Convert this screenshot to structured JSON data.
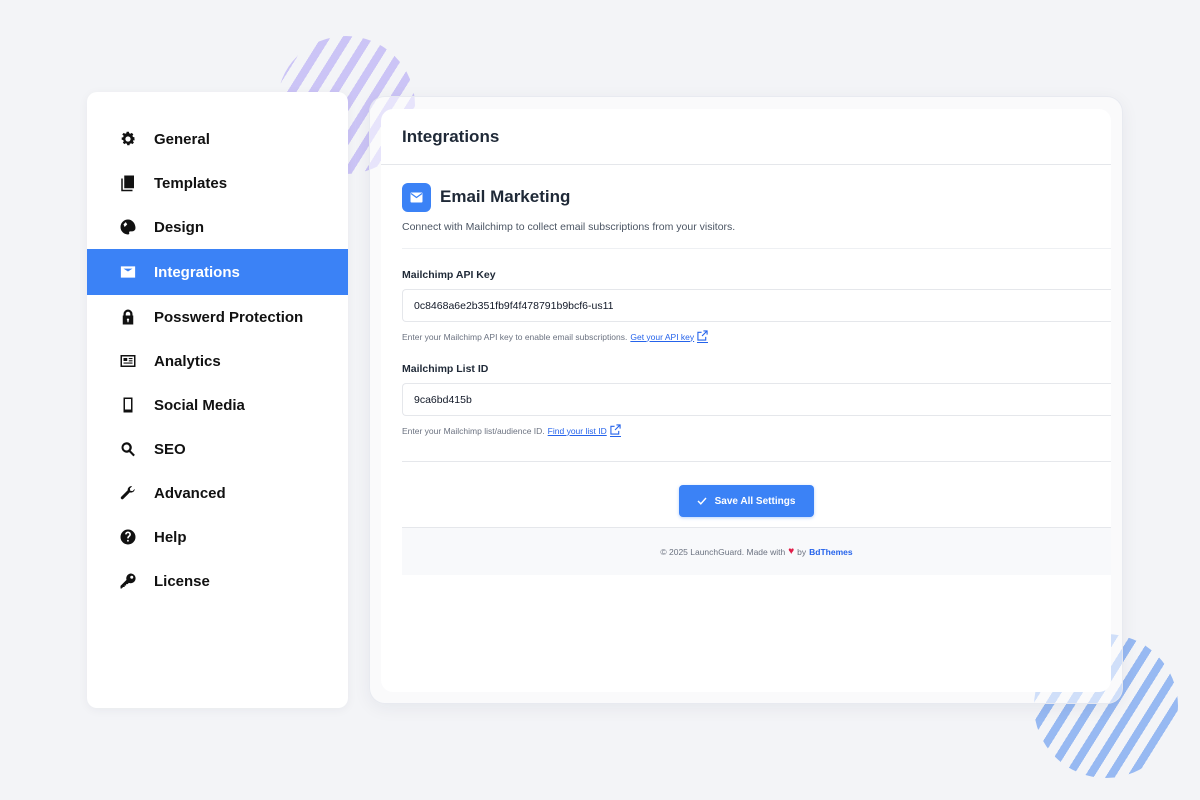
{
  "sidebar": {
    "items": [
      {
        "label": "General",
        "icon": "gear-icon",
        "active": false
      },
      {
        "label": "Templates",
        "icon": "copy-icon",
        "active": false
      },
      {
        "label": "Design",
        "icon": "palette-icon",
        "active": false
      },
      {
        "label": "Integrations",
        "icon": "mail-icon",
        "active": true
      },
      {
        "label": "Posswerd Protection",
        "icon": "lock-icon",
        "active": false
      },
      {
        "label": "Analytics",
        "icon": "newspaper-icon",
        "active": false
      },
      {
        "label": "Social Media",
        "icon": "phone-icon",
        "active": false
      },
      {
        "label": "SEO",
        "icon": "search-icon",
        "active": false
      },
      {
        "label": "Advanced",
        "icon": "wrench-icon",
        "active": false
      },
      {
        "label": "Help",
        "icon": "help-icon",
        "active": false
      },
      {
        "label": "License",
        "icon": "key-icon",
        "active": false
      }
    ]
  },
  "panel": {
    "title": "Integrations"
  },
  "section": {
    "title": "Email Marketing",
    "icon": "mail-icon",
    "description": "Connect with Mailchimp to collect email subscriptions from your visitors."
  },
  "fields": {
    "api_key": {
      "label": "Mailchimp API Key",
      "value": "0c8468a6e2b351fb9f4f478791b9bcf6-us11",
      "help": "Enter your Mailchimp API key to enable email subscriptions.",
      "link": "Get your API key"
    },
    "list_id": {
      "label": "Mailchimp List ID",
      "value": "9ca6bd415b",
      "help": "Enter your Mailchimp list/audience ID.",
      "link": "Find your list ID"
    }
  },
  "actions": {
    "save_label": "Save All Settings"
  },
  "footer": {
    "prefix": "© 2025 LaunchGuard. Made with",
    "heart": "♥",
    "by": "by",
    "brand": "BdThemes"
  },
  "colors": {
    "accent": "#3b82f6",
    "link": "#2563eb",
    "background": "#f3f4f7"
  }
}
